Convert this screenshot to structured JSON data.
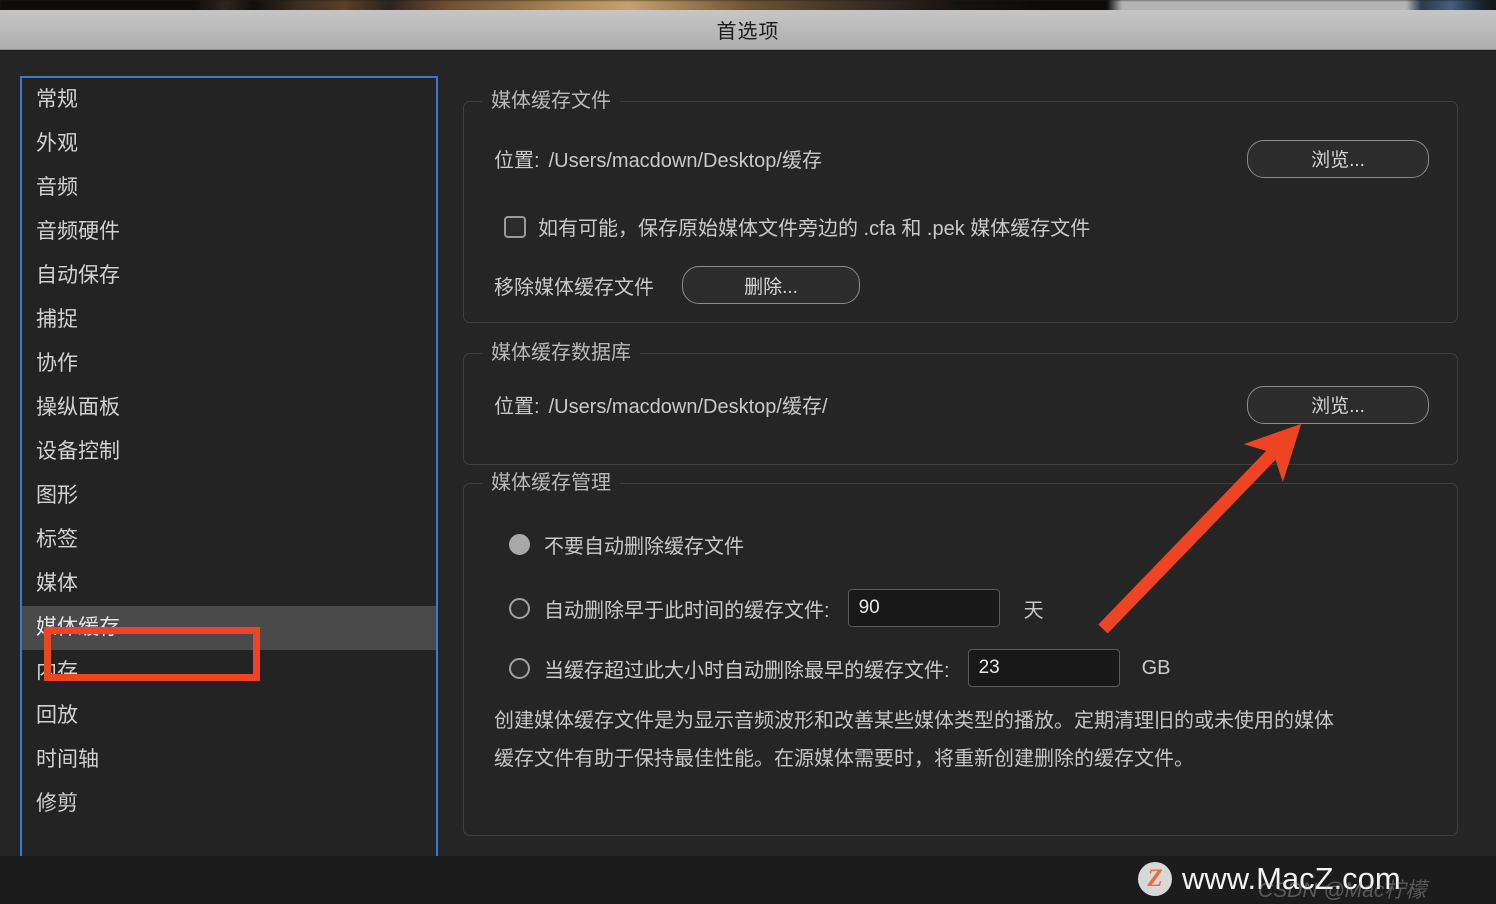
{
  "window": {
    "title": "首选项"
  },
  "sidebar": {
    "selected_index": 13,
    "items": [
      {
        "label": "常规"
      },
      {
        "label": "外观"
      },
      {
        "label": "音频"
      },
      {
        "label": "音频硬件"
      },
      {
        "label": "自动保存"
      },
      {
        "label": "捕捉"
      },
      {
        "label": "协作"
      },
      {
        "label": "操纵面板"
      },
      {
        "label": "设备控制"
      },
      {
        "label": "图形"
      },
      {
        "label": "标签"
      },
      {
        "label": "媒体"
      },
      {
        "label": "媒体缓存"
      },
      {
        "label": "内存"
      },
      {
        "label": "回放"
      },
      {
        "label": "时间轴"
      },
      {
        "label": "修剪"
      }
    ]
  },
  "media_cache_files": {
    "legend": "媒体缓存文件",
    "location_label": "位置:",
    "location_value": "/Users/macdown/Desktop/缓存",
    "browse_button": "浏览...",
    "checkbox_label": "如有可能，保存原始媒体文件旁边的 .cfa 和 .pek 媒体缓存文件",
    "checkbox_checked": false,
    "remove_label": "移除媒体缓存文件",
    "delete_button": "删除..."
  },
  "media_cache_database": {
    "legend": "媒体缓存数据库",
    "location_label": "位置:",
    "location_value": "/Users/macdown/Desktop/缓存/",
    "browse_button": "浏览..."
  },
  "media_cache_management": {
    "legend": "媒体缓存管理",
    "options": [
      {
        "label": "不要自动删除缓存文件",
        "selected": true
      },
      {
        "label": "自动删除早于此时间的缓存文件:",
        "selected": false,
        "value": "90",
        "unit": "天"
      },
      {
        "label": "当缓存超过此大小时自动删除最早的缓存文件:",
        "selected": false,
        "value": "23",
        "unit": "GB"
      }
    ],
    "description": "创建媒体缓存文件是为显示音频波形和改善某些媒体类型的播放。定期清理旧的或未使用的媒体缓存文件有助于保持最佳性能。在源媒体需要时，将重新创建删除的缓存文件。"
  },
  "annotations": {
    "accent_color": "#ef4423",
    "callout_target": "媒体缓存",
    "arrow_target": "浏览..."
  },
  "watermark": {
    "badge": "Z",
    "text": "www.MacZ.com",
    "csdn": "CSDN @Mac柠檬"
  }
}
